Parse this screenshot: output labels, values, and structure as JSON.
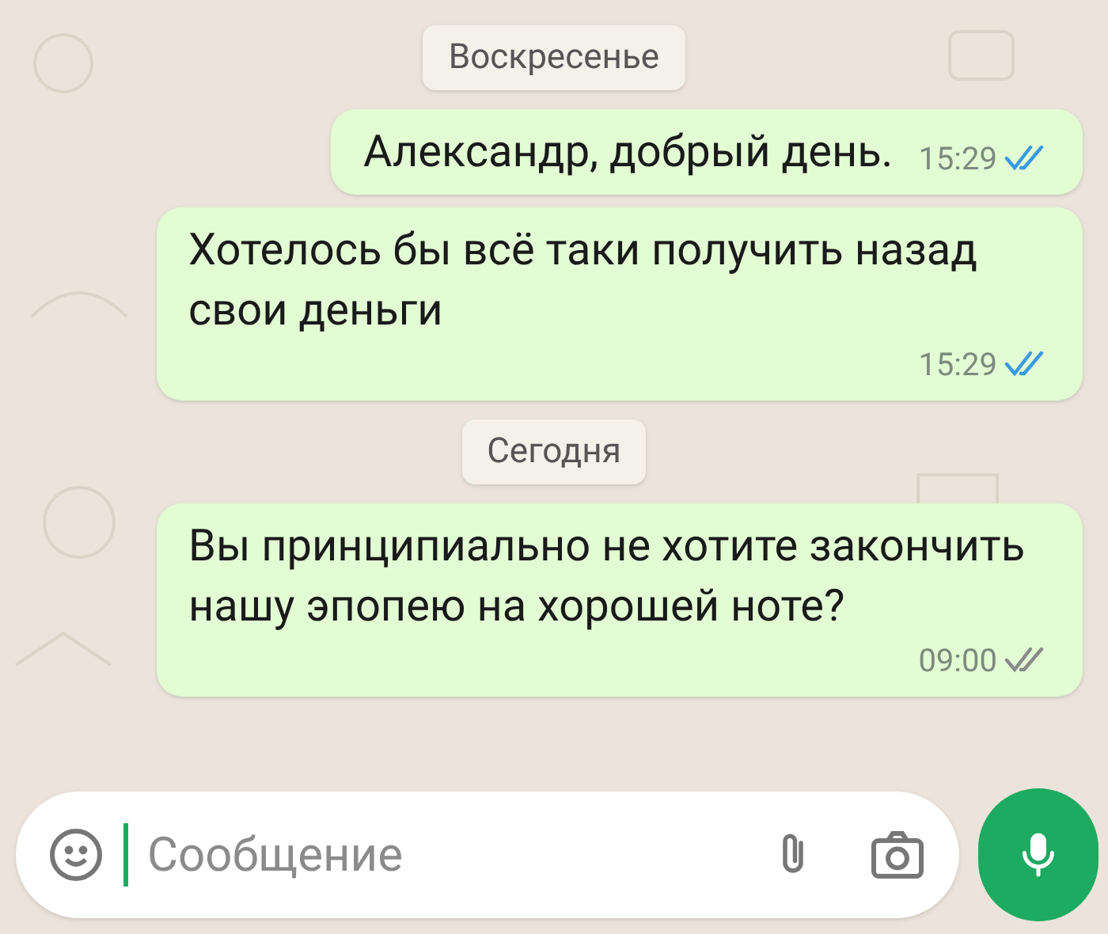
{
  "messages": [
    {
      "kind": "date",
      "text": "Воскресенье"
    },
    {
      "kind": "outgoing",
      "text": "Александр, добрый день.",
      "time": "15:29",
      "read": true
    },
    {
      "kind": "outgoing",
      "text": "Хотелось бы всё таки получить назад свои деньги",
      "time": "15:29",
      "read": true
    },
    {
      "kind": "date",
      "text": "Сегодня"
    },
    {
      "kind": "outgoing",
      "text": "Вы принципиально не хотите закончить нашу эпопею на хорошей ноте?",
      "time": "09:00",
      "read": false
    }
  ],
  "composer": {
    "placeholder": "Сообщение"
  }
}
